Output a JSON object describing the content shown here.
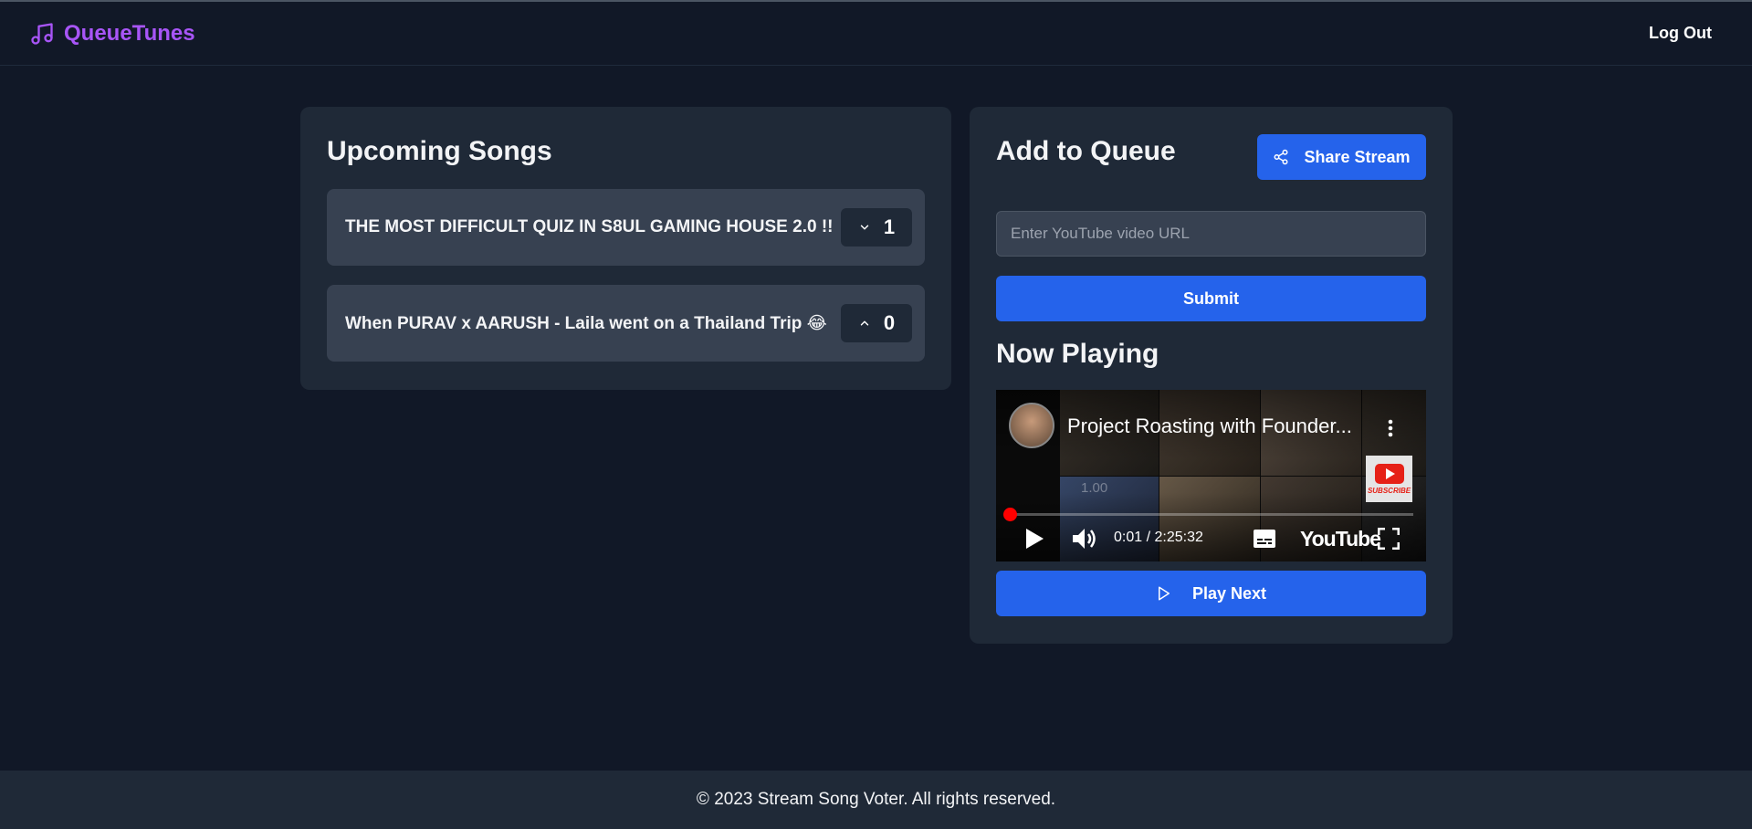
{
  "app": {
    "name": "QueueTunes",
    "logout_label": "Log Out"
  },
  "queue": {
    "title": "Upcoming Songs",
    "songs": [
      {
        "title": "THE MOST DIFFICULT QUIZ IN S8UL GAMING HOUSE 2.0 !!",
        "votes": "1",
        "vote_icon": "chevron-down-icon"
      },
      {
        "title": "When PURAV x AARUSH - Laila went on a Thailand Trip 😂",
        "votes": "0",
        "vote_icon": "chevron-up-icon"
      }
    ]
  },
  "add": {
    "title": "Add to Queue",
    "share_label": "Share Stream",
    "url_placeholder": "Enter YouTube video URL",
    "url_value": "",
    "submit_label": "Submit"
  },
  "now_playing": {
    "title": "Now Playing",
    "video_title": "Project Roasting with Founder...",
    "time": "0:01 / 2:25:32",
    "progress": 0.0001,
    "overlay_label": "1.00",
    "youtube_label": "YouTube",
    "subscribe_label": "SUBSCRIBE",
    "play_next_label": "Play Next"
  },
  "footer": {
    "text": "© 2023 Stream Song Voter. All rights reserved."
  },
  "colors": {
    "background": "#111827",
    "card": "#1f2937",
    "item": "#374151",
    "accent": "#2563eb",
    "brand": "#a855f7"
  }
}
